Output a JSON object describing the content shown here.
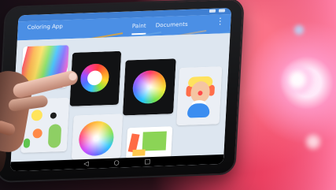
{
  "screen": {
    "app_title": "Coloring App",
    "tabs": [
      {
        "label": "Paint",
        "active": true
      },
      {
        "label": "Documents",
        "active": false
      }
    ],
    "menu_icon": "more-vert-icon"
  },
  "icons": {
    "back": "◁",
    "home": "○",
    "recent": "□"
  }
}
